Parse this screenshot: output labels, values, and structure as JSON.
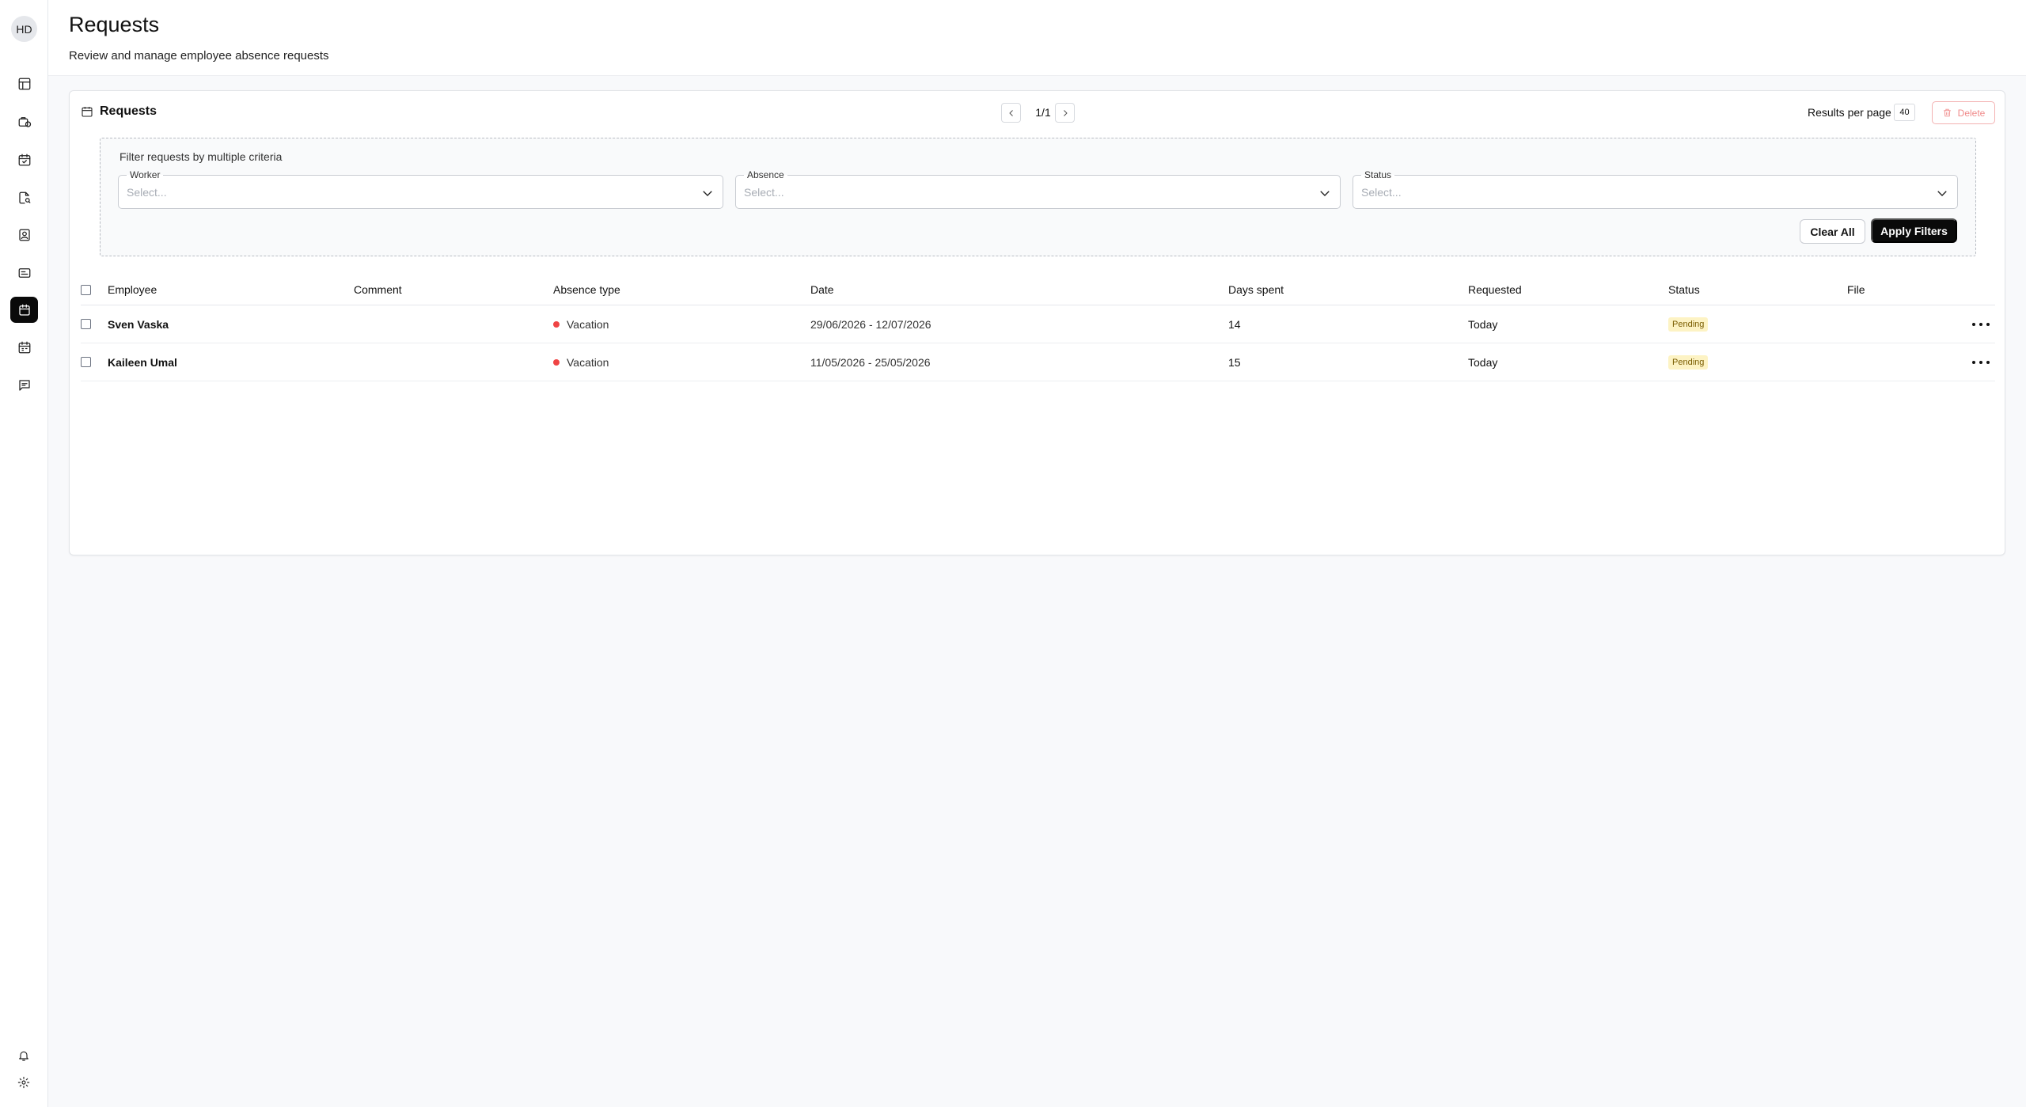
{
  "user": {
    "initials": "HD"
  },
  "sidebar": {
    "items": [
      {
        "icon": "layout-dashboard-icon"
      },
      {
        "icon": "briefcase-clock-icon"
      },
      {
        "icon": "calendar-check-icon"
      },
      {
        "icon": "file-search-icon"
      },
      {
        "icon": "address-book-icon"
      },
      {
        "icon": "id-card-icon"
      },
      {
        "icon": "calendar-active-icon",
        "active": true
      },
      {
        "icon": "calendar-grid-icon"
      },
      {
        "icon": "message-icon"
      }
    ],
    "bottom": [
      {
        "icon": "bell-icon"
      },
      {
        "icon": "gear-icon"
      }
    ]
  },
  "header": {
    "title": "Requests",
    "subtitle": "Review and manage employee absence requests"
  },
  "card": {
    "title": "Requests",
    "pagination": {
      "text": "1/1"
    },
    "results_per_page_label": "Results per page",
    "results_per_page_value": "40",
    "delete_label": "Delete"
  },
  "filters": {
    "heading": "Filter requests by multiple criteria",
    "fields": [
      {
        "label": "Worker",
        "placeholder": "Select..."
      },
      {
        "label": "Absence",
        "placeholder": "Select..."
      },
      {
        "label": "Status",
        "placeholder": "Select..."
      }
    ],
    "clear_label": "Clear All",
    "apply_label": "Apply Filters"
  },
  "table": {
    "columns": [
      "Employee",
      "Comment",
      "Absence type",
      "Date",
      "Days spent",
      "Requested",
      "Status",
      "File"
    ],
    "rows": [
      {
        "employee": "Sven Vaska",
        "comment": "",
        "absence_type": "Vacation",
        "date": "29/06/2026 - 12/07/2026",
        "days": "14",
        "requested": "Today",
        "status": "Pending",
        "file": ""
      },
      {
        "employee": "Kaileen Umal",
        "comment": "",
        "absence_type": "Vacation",
        "date": "11/05/2026 - 25/05/2026",
        "days": "15",
        "requested": "Today",
        "status": "Pending",
        "file": ""
      }
    ]
  },
  "colors": {
    "vacation_dot": "#ef4444",
    "pending_bg": "#fdf3c4",
    "pending_text": "#7a5d00",
    "accent": "#0a0a0a"
  }
}
